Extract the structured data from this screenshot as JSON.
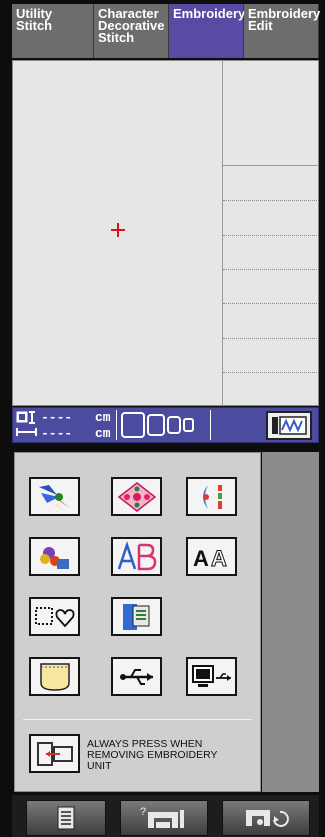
{
  "tabs": [
    {
      "label": "Utility\nStitch"
    },
    {
      "label": "Character\nDecorative\nStitch"
    },
    {
      "label": "Embroidery"
    },
    {
      "label": "Embroidery\nEdit"
    }
  ],
  "status": {
    "height_value": "----",
    "height_unit": "cm",
    "width_value": "----",
    "width_unit": "cm"
  },
  "buttons": {
    "row1": [
      "bird-pattern-icon",
      "floral-frame-pattern-icon",
      "ornament-pattern-icon"
    ],
    "row2": [
      "fruit-pattern-icon",
      "alphabet-font-icon",
      "alphabet-outline-font-icon"
    ],
    "row3": [
      "frame-shapes-icon",
      "memory-card-icon"
    ],
    "row4": [
      "pocket-storage-icon",
      "usb-icon",
      "computer-usb-icon"
    ]
  },
  "notice": {
    "text": "ALWAYS PRESS WHEN\nREMOVING EMBROIDERY\nUNIT"
  },
  "colors": {
    "active_tab": "#5b4aa3",
    "status_bar": "#4b4ba0",
    "center_marker": "#e0101a"
  }
}
